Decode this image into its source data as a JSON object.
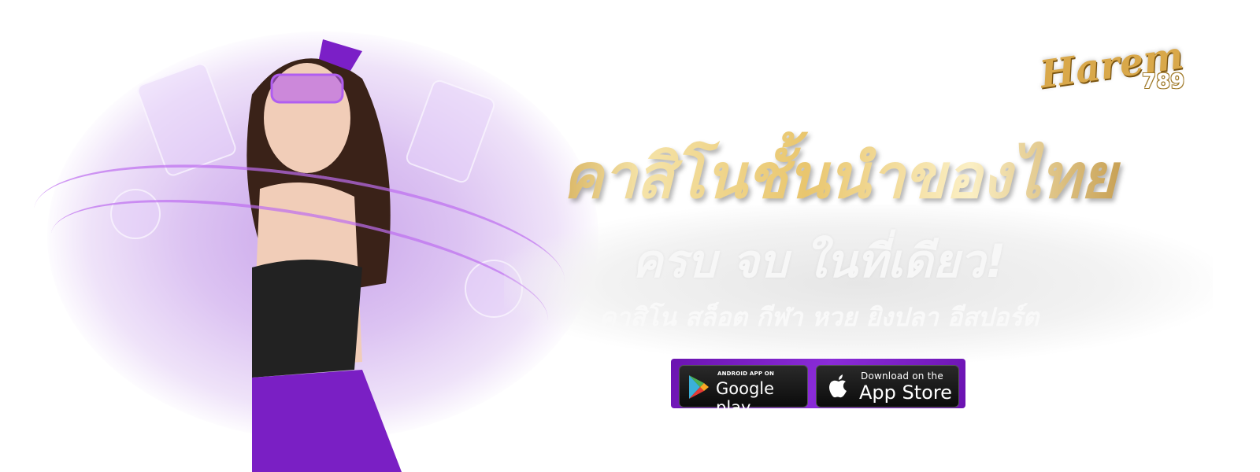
{
  "brand": {
    "logo_text": "Harem",
    "logo_number": "789"
  },
  "headline": "คาสิโนชั้นนำของไทย",
  "subheadline": "ครบ จบ ในที่เดียว!",
  "categories": "คาสิโน สล็อต กีฬา หวย ยิงปลา อีสปอร์ต",
  "stores": {
    "google_play": {
      "small": "ANDROID APP ON",
      "big": "Google play"
    },
    "app_store": {
      "small": "Download on the",
      "big": "App Store"
    }
  },
  "colors": {
    "purple": "#7a1fc4",
    "gold": "#e2b85c"
  }
}
